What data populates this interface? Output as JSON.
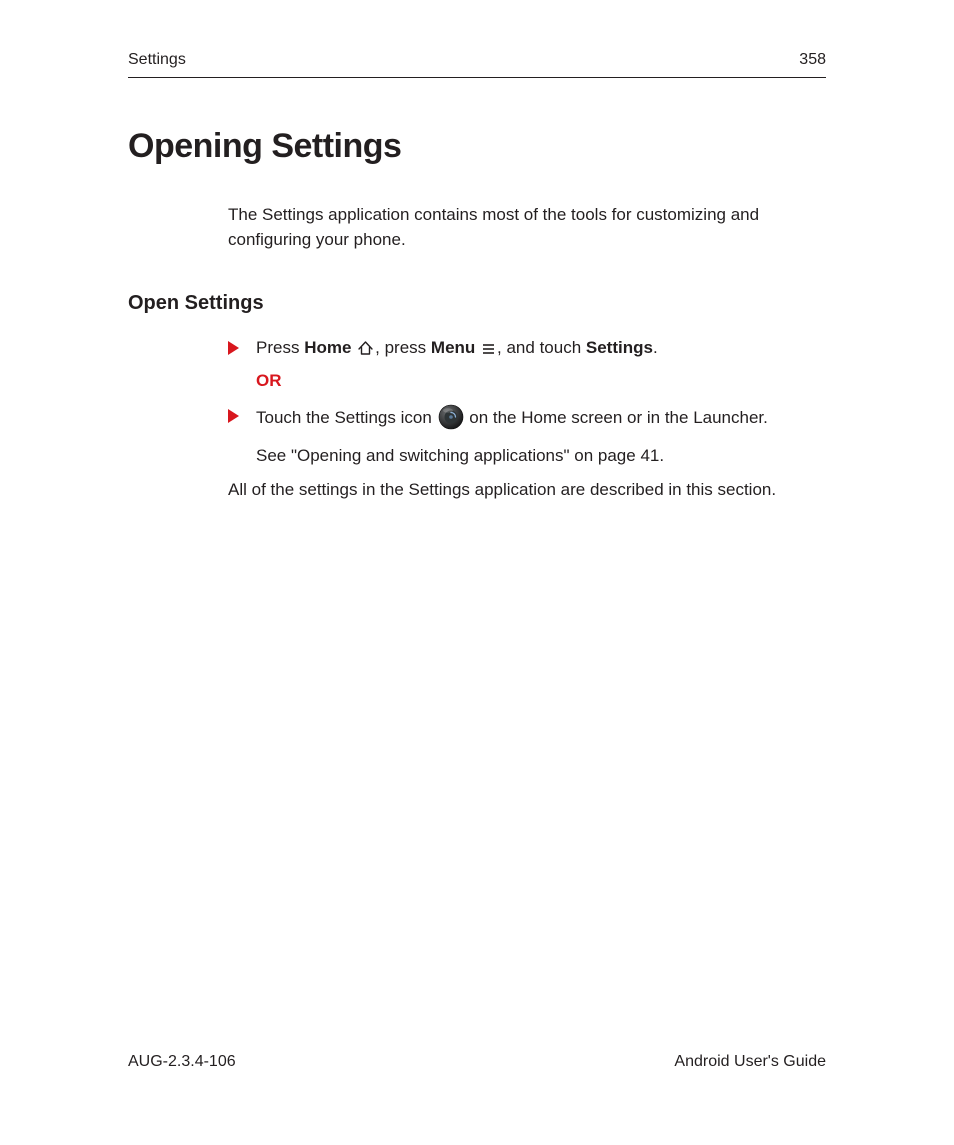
{
  "header": {
    "left": "Settings",
    "right": "358"
  },
  "title": "Opening Settings",
  "intro": "The Settings application contains most of the tools for customizing and configuring your phone.",
  "subhead": "Open Settings",
  "step1": {
    "press": "Press ",
    "home": "Home",
    "press_menu": ", press ",
    "menu": "Menu",
    "and_touch": ", and touch ",
    "settings": "Settings",
    "period": "."
  },
  "or": "OR",
  "step2": {
    "touch": "Touch the Settings icon ",
    "rest": " on the Home screen or in the Launcher.",
    "see": "See \"Opening and switching applications\" on page 41."
  },
  "closing": "All of the settings in the Settings application are described in this section.",
  "footer": {
    "left": "AUG-2.3.4-106",
    "right": "Android User's Guide"
  }
}
